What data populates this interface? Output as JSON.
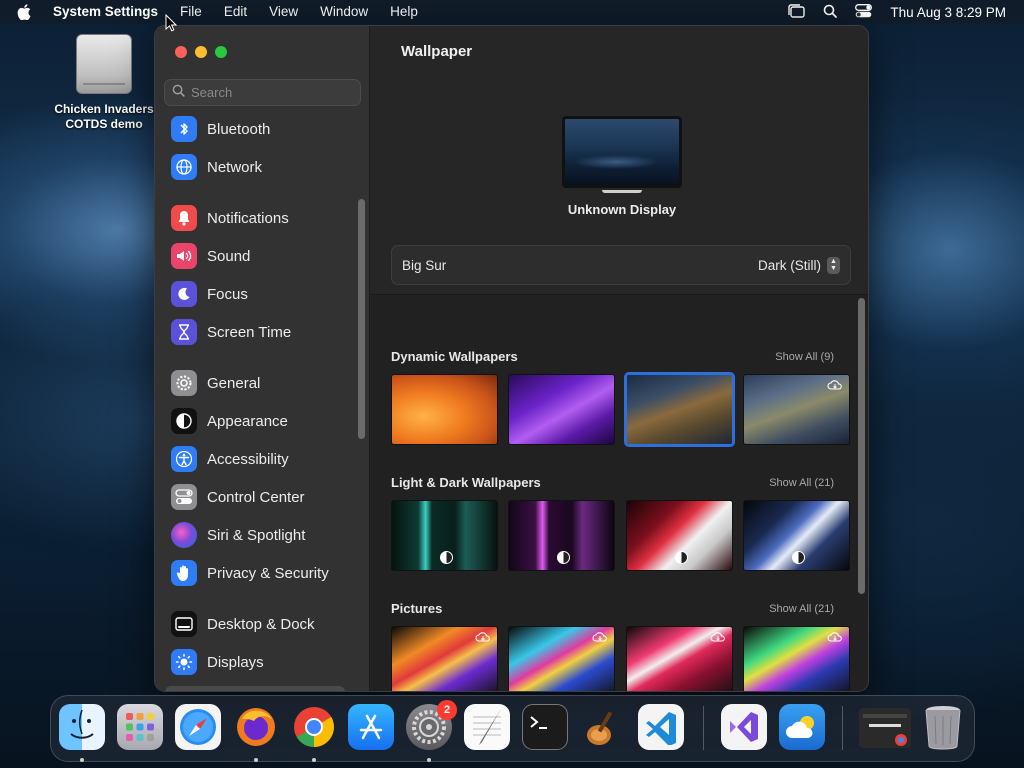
{
  "menubar": {
    "app_name": "System Settings",
    "menus": [
      "File",
      "Edit",
      "View",
      "Window",
      "Help"
    ],
    "clock": "Thu Aug 3  8:29 PM"
  },
  "desktop": {
    "icon_label_line1": "Chicken Invaders",
    "icon_label_line2": "COTDS demo"
  },
  "sidebar": {
    "search_placeholder": "Search",
    "items": [
      {
        "label": "Bluetooth",
        "icon": "bluetooth-icon",
        "color": "#2f7cf6"
      },
      {
        "label": "Network",
        "icon": "globe-icon",
        "color": "#2f7cf6"
      },
      {
        "label": "Notifications",
        "icon": "bell-icon",
        "color": "#ef4b4b"
      },
      {
        "label": "Sound",
        "icon": "speaker-icon",
        "color": "#e9456b"
      },
      {
        "label": "Focus",
        "icon": "moon-icon",
        "color": "#5b52d9"
      },
      {
        "label": "Screen Time",
        "icon": "hourglass-icon",
        "color": "#5b52d9"
      },
      {
        "label": "General",
        "icon": "gear-icon",
        "color": "#8e8e93"
      },
      {
        "label": "Appearance",
        "icon": "appearance-icon",
        "color": "#1c1c1c"
      },
      {
        "label": "Accessibility",
        "icon": "accessibility-icon",
        "color": "#2f7cf6"
      },
      {
        "label": "Control Center",
        "icon": "control-center-icon",
        "color": "#8e8e93"
      },
      {
        "label": "Siri & Spotlight",
        "icon": "siri-icon",
        "color": "#7b4bd8"
      },
      {
        "label": "Privacy & Security",
        "icon": "hand-icon",
        "color": "#2f7cf6"
      },
      {
        "label": "Desktop & Dock",
        "icon": "dock-icon",
        "color": "#1c1c1c"
      },
      {
        "label": "Displays",
        "icon": "sun-icon",
        "color": "#2f7cf6"
      }
    ]
  },
  "main": {
    "title": "Wallpaper",
    "display_name": "Unknown Display",
    "wallpaper_name": "Big Sur",
    "appearance_value": "Dark (Still)",
    "sections": [
      {
        "title": "Dynamic Wallpapers",
        "show_all": "Show All (9)"
      },
      {
        "title": "Light & Dark Wallpapers",
        "show_all": "Show All (21)"
      },
      {
        "title": "Pictures",
        "show_all": "Show All (21)"
      }
    ]
  },
  "dock": {
    "apps": [
      "Finder",
      "Launchpad",
      "Safari",
      "Firefox",
      "Chrome",
      "App Store",
      "System Settings",
      "TextEdit",
      "Terminal",
      "Instruments",
      "Visual Studio Code",
      "Visual Studio",
      "Weather",
      "Chrome Window",
      "Trash"
    ],
    "settings_badge": "2"
  }
}
